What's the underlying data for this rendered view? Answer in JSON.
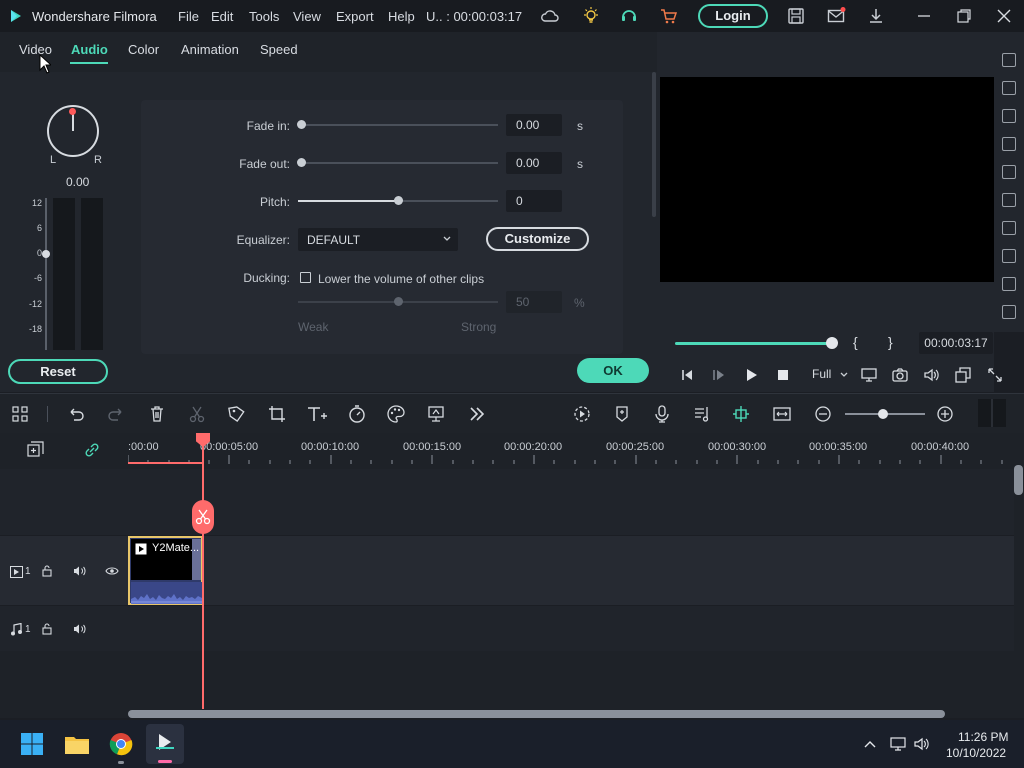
{
  "app": {
    "title": "Wondershare Filmora",
    "menu": [
      "File",
      "Edit",
      "Tools",
      "View",
      "Export",
      "Help"
    ],
    "project_timecode": "U.. : 00:00:03:17",
    "login_label": "Login"
  },
  "tabs": [
    {
      "label": "Video"
    },
    {
      "label": "Audio"
    },
    {
      "label": "Color"
    },
    {
      "label": "Animation"
    },
    {
      "label": "Speed"
    }
  ],
  "audio": {
    "pan": {
      "left": "L",
      "right": "R",
      "value": "0.00"
    },
    "meter_scale": [
      "12",
      "6",
      "0",
      "-6",
      "-12",
      "-18"
    ],
    "fade_in": {
      "label": "Fade in:",
      "value": "0.00",
      "unit": "s"
    },
    "fade_out": {
      "label": "Fade out:",
      "value": "0.00",
      "unit": "s"
    },
    "pitch": {
      "label": "Pitch:",
      "value": "0",
      "slider_fraction": 0.5
    },
    "equalizer": {
      "label": "Equalizer:",
      "selected": "DEFAULT",
      "customize_label": "Customize"
    },
    "ducking": {
      "label": "Ducking:",
      "checkbox_label": "Lower the volume of other clips",
      "value": "50",
      "unit": "%",
      "weak": "Weak",
      "strong": "Strong"
    },
    "reset_label": "Reset",
    "ok_label": "OK"
  },
  "preview": {
    "timecode": "00:00:03:17",
    "bracket_in": "{",
    "bracket_out": "}",
    "quality": "Full"
  },
  "timeline": {
    "ticks": [
      ":00:00",
      "00:00:05:00",
      "00:00:10:00",
      "00:00:15:00",
      "00:00:20:00",
      "00:00:25:00",
      "00:00:30:00",
      "00:00:35:00",
      "00:00:40:00"
    ],
    "video_track": {
      "number": "1"
    },
    "audio_track": {
      "number": "1"
    },
    "clip_name": "Y2Mate..."
  },
  "taskbar": {
    "time": "11:26 PM",
    "date": "10/10/2022"
  },
  "colors": {
    "accent": "#4dd9b8",
    "playhead": "#ff6b6b"
  }
}
